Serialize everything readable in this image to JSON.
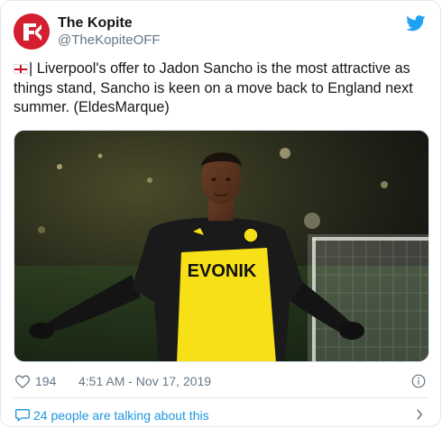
{
  "account": {
    "display_name": "The Kopite",
    "handle": "@TheKopiteOFF"
  },
  "tweet": {
    "flag_icon": "england-flag",
    "text": "| Liverpool's offer to Jadon Sancho is the most attractive as things stand, Sancho is keen on a move back to England next summer. (EldesMarque)"
  },
  "media": {
    "description_icon": "photo",
    "sponsor_text": "EVONIK"
  },
  "engagement": {
    "likes": "194",
    "timestamp": "4:51 AM - Nov 17, 2019"
  },
  "footer": {
    "talking_label": "24 people are talking about this"
  },
  "colors": {
    "link": "#1b95e0",
    "brand_red": "#d31f2f",
    "twitter_blue": "#1da1f2",
    "jersey_yellow": "#f7e017"
  }
}
